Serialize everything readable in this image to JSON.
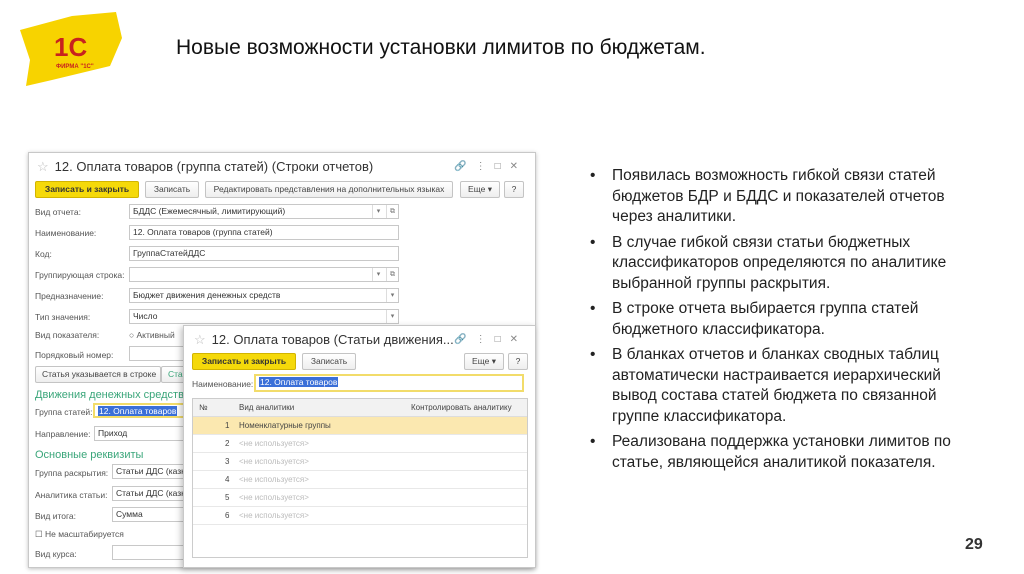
{
  "logo": {
    "text": "1С",
    "subtext": "ФИРМА \"1С\""
  },
  "title": "Новые возможности установки лимитов по бюджетам.",
  "window1": {
    "title": "12. Оплата товаров (группа статей) (Строки отчетов)",
    "buttons": {
      "save_close": "Записать и закрыть",
      "save": "Записать",
      "edit_lang": "Редактировать представления на дополнительных языках",
      "more": "Еще ▾",
      "help": "?"
    },
    "fields": [
      {
        "label": "Вид отчета:",
        "value": "БДДС (Ежемесячный, лимитирующий)"
      },
      {
        "label": "Наименование:",
        "value": "12. Оплата товаров (группа статей)"
      },
      {
        "label": "Код:",
        "value": "ГруппаСтатейДДС"
      },
      {
        "label": "Группирующая строка:",
        "value": ""
      },
      {
        "label": "Предназначение:",
        "value": "Бюджет движения денежных средств"
      },
      {
        "label": "Тип значения:",
        "value": "Число"
      }
    ],
    "indicator_label": "Вид показателя:",
    "indicator_option": "Активный",
    "order_label": "Порядковый номер:",
    "tab_article": "Статья указывается в строке",
    "tab_other": "Ста",
    "section_cash": "Движения денежных средств",
    "group_label": "Группа статей:",
    "group_value": "12. Оплата товаров",
    "direction_label": "Направление:",
    "direction_value": "Приход",
    "section_main": "Основные реквизиты",
    "disclosure_label": "Группа раскрытия:",
    "disclosure_value": "Статьи ДДС (казн",
    "analytics_label": "Аналитика статьи:",
    "analytics_value": "Статьи ДДС (казн",
    "total_label": "Вид итога:",
    "total_value": "Сумма",
    "no_scale": "Не масштабируется",
    "rate_label": "Вид курса:"
  },
  "window2": {
    "title": "12. Оплата товаров (Статьи движения...",
    "buttons": {
      "save_close": "Записать и закрыть",
      "save": "Записать",
      "more": "Еще ▾",
      "help": "?"
    },
    "name_label": "Наименование:",
    "name_value": "12. Оплата товаров",
    "columns": [
      "№",
      "Вид аналитики",
      "Контролировать аналитику"
    ],
    "rows": [
      {
        "n": "1",
        "kind": "Номенклатурные группы"
      },
      {
        "n": "2",
        "kind": "<не используется>"
      },
      {
        "n": "3",
        "kind": "<не используется>"
      },
      {
        "n": "4",
        "kind": "<не используется>"
      },
      {
        "n": "5",
        "kind": "<не используется>"
      },
      {
        "n": "6",
        "kind": "<не используется>"
      }
    ]
  },
  "bullets": [
    "Появилась возможность гибкой связи статей бюджетов БДР и БДДС и показателей отчетов через аналитики.",
    "В случае гибкой связи статьи бюджетных классификаторов определяются  по аналитике выбранной группы раскрытия.",
    "В строке отчета выбирается группа статей бюджетного классификатора.",
    "В бланках отчетов и бланках сводных таблиц автоматически настраивается иерархический вывод состава статей бюджета по связанной группе классификатора.",
    "Реализована поддержка установки лимитов по статье, являющейся аналитикой показателя."
  ],
  "page_number": "29"
}
